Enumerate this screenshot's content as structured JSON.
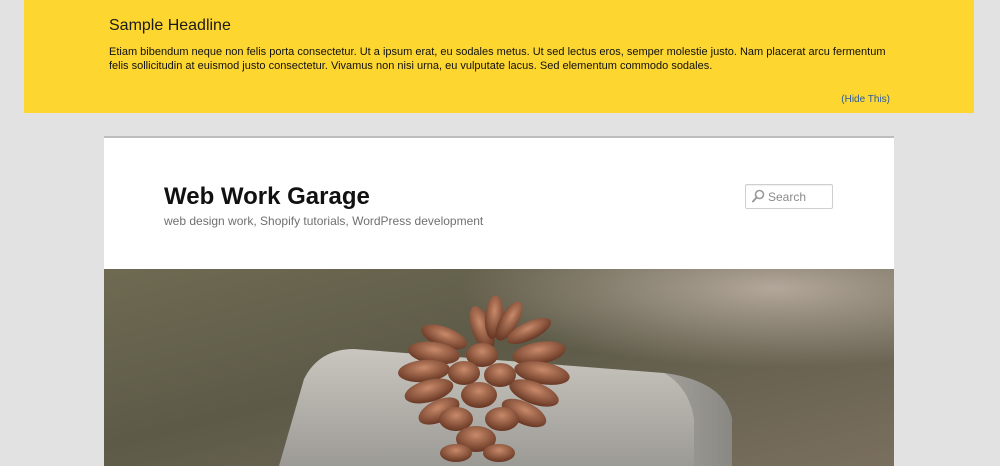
{
  "notice": {
    "title": "Sample Headline",
    "body": "Etiam bibendum neque non felis porta consectetur. Ut a ipsum erat, eu sodales metus. Ut sed lectus eros, semper molestie justo. Nam placerat arcu fermentum felis sollicitudin at euismod justo consectetur. Vivamus non nisi urna, eu vulputate lacus. Sed elementum commodo sodales.",
    "hide_label": "(Hide This)",
    "background": "#fed630"
  },
  "header": {
    "site_title": "Web Work Garage",
    "site_description": "web design work, Shopify tutorials, WordPress development"
  },
  "search": {
    "placeholder": "Search",
    "icon": "search-icon"
  },
  "banner": {
    "subject": "pine-cone-on-granite-image"
  }
}
